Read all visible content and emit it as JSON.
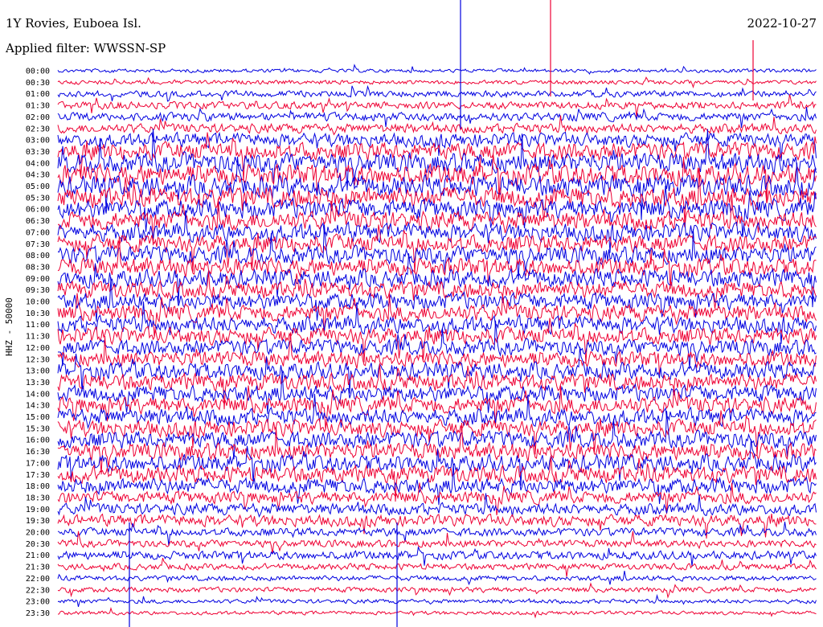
{
  "header": {
    "station": "1Y Rovies, Euboea Isl.",
    "date": "2022-10-27",
    "filter": "Applied filter: WWSSN-SP"
  },
  "chart_data": {
    "type": "line",
    "description_free": true,
    "ylabel": "HHZ - 50000",
    "row_labels": [
      "00:00",
      "00:30",
      "01:00",
      "01:30",
      "02:00",
      "02:30",
      "03:00",
      "03:30",
      "04:00",
      "04:30",
      "05:00",
      "05:30",
      "06:00",
      "06:30",
      "07:00",
      "07:30",
      "08:00",
      "08:30",
      "09:00",
      "09:30",
      "10:00",
      "10:30",
      "11:00",
      "11:30",
      "12:00",
      "12:30",
      "13:00",
      "13:30",
      "14:00",
      "14:30",
      "15:00",
      "15:30",
      "16:00",
      "16:30",
      "17:00",
      "17:30",
      "18:00",
      "18:30",
      "19:00",
      "19:30",
      "20:00",
      "20:30",
      "21:00",
      "21:30",
      "22:00",
      "22:30",
      "23:00",
      "23:30"
    ],
    "row_amplitude": [
      0.35,
      0.4,
      0.6,
      0.7,
      0.8,
      0.9,
      1.3,
      1.7,
      1.9,
      2.0,
      2.0,
      2.0,
      1.9,
      1.8,
      1.7,
      1.7,
      1.7,
      1.7,
      1.7,
      1.6,
      1.6,
      1.6,
      1.6,
      1.6,
      1.5,
      1.5,
      1.6,
      1.6,
      1.6,
      1.6,
      1.6,
      1.6,
      1.6,
      1.6,
      1.6,
      1.6,
      1.5,
      1.2,
      1.1,
      1.1,
      0.8,
      0.7,
      0.8,
      0.6,
      0.5,
      0.5,
      0.4,
      0.35
    ],
    "colors": [
      "#0000e0",
      "#ee0033"
    ]
  }
}
